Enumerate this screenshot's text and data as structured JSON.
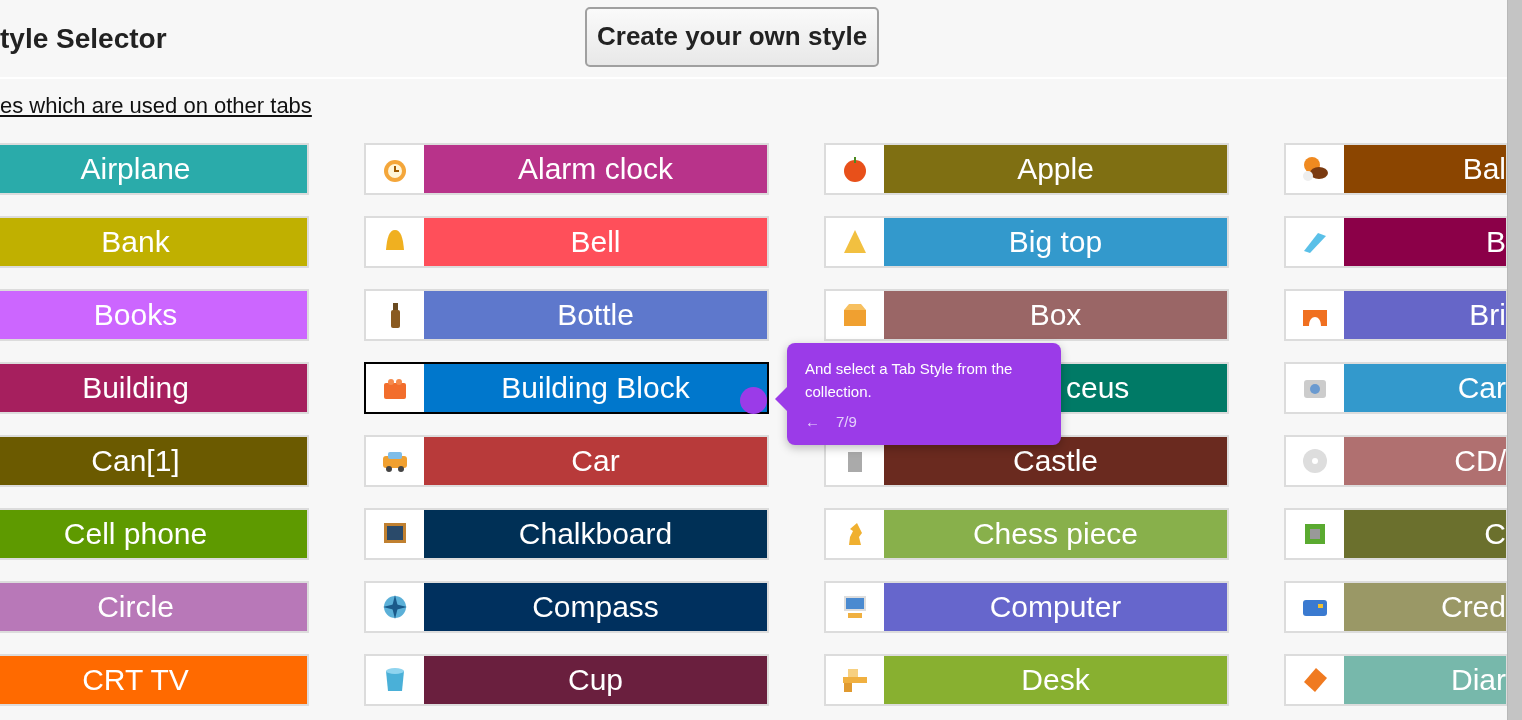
{
  "header": {
    "title": "tyle Selector",
    "create_button": "Create your own style"
  },
  "link": "es which are used on other tabs",
  "rows": [
    [
      {
        "label": "Airplane",
        "color": "#2aabaa",
        "selected": false,
        "covered": false
      },
      {
        "label": "Alarm clock",
        "color": "#b8338a",
        "selected": false,
        "covered": false
      },
      {
        "label": "Apple",
        "color": "#7f6f12",
        "selected": false,
        "covered": false
      },
      {
        "label": "Bal",
        "color": "#8b4500",
        "selected": false,
        "covered": false
      }
    ],
    [
      {
        "label": "Bank",
        "color": "#c0b000",
        "selected": false,
        "covered": false
      },
      {
        "label": "Bell",
        "color": "#ff4f5a",
        "selected": false,
        "covered": false
      },
      {
        "label": "Big top",
        "color": "#3399cc",
        "selected": false,
        "covered": false
      },
      {
        "label": "B",
        "color": "#8b0048",
        "selected": false,
        "covered": false
      }
    ],
    [
      {
        "label": "Books",
        "color": "#cc66ff",
        "selected": false,
        "covered": false
      },
      {
        "label": "Bottle",
        "color": "#5e78cc",
        "selected": false,
        "covered": false
      },
      {
        "label": "Box",
        "color": "#9a6666",
        "selected": false,
        "covered": false
      },
      {
        "label": "Bri",
        "color": "#6666c8",
        "selected": false,
        "covered": false
      }
    ],
    [
      {
        "label": "Building",
        "color": "#a61f5e",
        "selected": false,
        "covered": false
      },
      {
        "label": "Building Block",
        "color": "#0077cc",
        "selected": true,
        "covered": false
      },
      {
        "label": "ceus",
        "color": "#007a66",
        "selected": false,
        "covered": true
      },
      {
        "label": "Car",
        "color": "#3399cc",
        "selected": false,
        "covered": false
      }
    ],
    [
      {
        "label": "Can[1]",
        "color": "#6b5a00",
        "selected": false,
        "covered": false
      },
      {
        "label": "Car",
        "color": "#b83a3a",
        "selected": false,
        "covered": false
      },
      {
        "label": "Castle",
        "color": "#6a2a1f",
        "selected": false,
        "covered": false
      },
      {
        "label": "CD/",
        "color": "#b07070",
        "selected": false,
        "covered": false
      }
    ],
    [
      {
        "label": "Cell phone",
        "color": "#5e9a00",
        "selected": false,
        "covered": false
      },
      {
        "label": "Chalkboard",
        "color": "#003056",
        "selected": false,
        "covered": false
      },
      {
        "label": "Chess piece",
        "color": "#88b04b",
        "selected": false,
        "covered": false
      },
      {
        "label": "C",
        "color": "#6b702d",
        "selected": false,
        "covered": false
      }
    ],
    [
      {
        "label": "Circle",
        "color": "#b878b8",
        "selected": false,
        "covered": false
      },
      {
        "label": "Compass",
        "color": "#00305e",
        "selected": false,
        "covered": false
      },
      {
        "label": "Computer",
        "color": "#6666cc",
        "selected": false,
        "covered": false
      },
      {
        "label": "Cred",
        "color": "#9a9866",
        "selected": false,
        "covered": false
      }
    ],
    [
      {
        "label": "CRT TV",
        "color": "#ff6a00",
        "selected": false,
        "covered": false
      },
      {
        "label": "Cup",
        "color": "#6a1f3e",
        "selected": false,
        "covered": false
      },
      {
        "label": "Desk",
        "color": "#88b030",
        "selected": false,
        "covered": false
      },
      {
        "label": "Diar",
        "color": "#77b8ab",
        "selected": false,
        "covered": false
      }
    ]
  ],
  "tooltip": {
    "text": "And select a Tab Style from the collection.",
    "back": "←",
    "step": "7/9"
  }
}
